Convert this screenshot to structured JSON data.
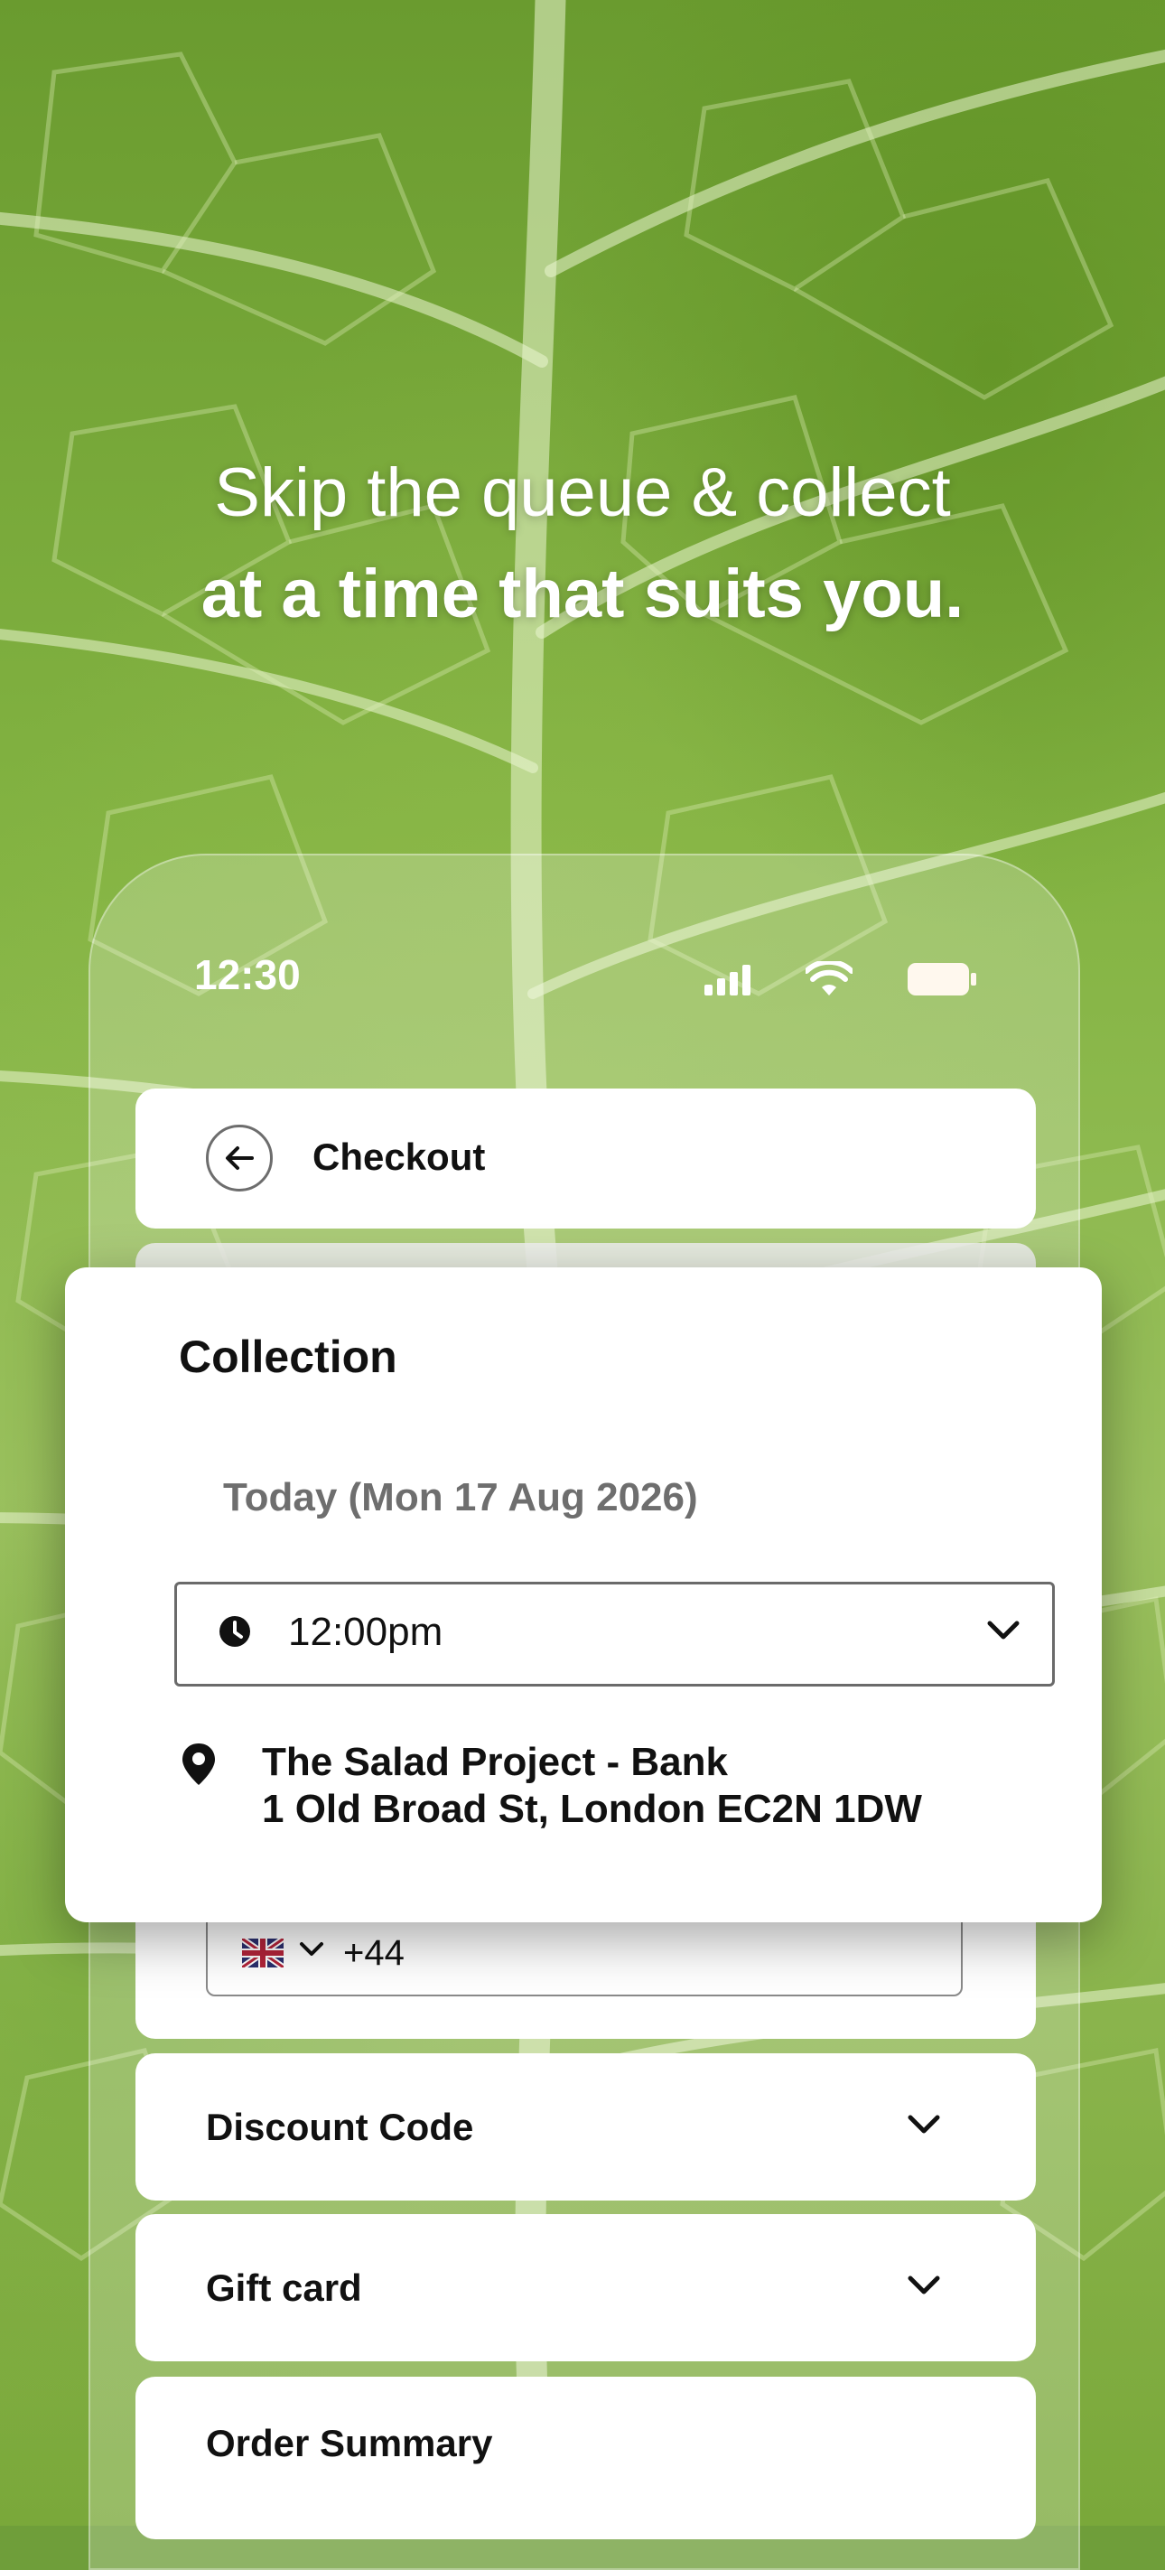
{
  "headline": {
    "line1": "Skip the queue & collect",
    "line2": "at a time that suits you."
  },
  "status_bar": {
    "time": "12:30",
    "icons": [
      "cellular-signal-icon",
      "wifi-icon",
      "battery-icon"
    ]
  },
  "checkout": {
    "title": "Checkout",
    "back_icon": "arrow-left-icon"
  },
  "collection": {
    "title": "Collection",
    "date": "Today (Mon 17 Aug 2026)",
    "time_value": "12:00pm",
    "store_name": "The Salad Project - Bank",
    "store_address": "1 Old Broad St, London EC2N 1DW"
  },
  "phone_field": {
    "country_flag": "uk-flag-icon",
    "dial_code": "+44"
  },
  "sections": {
    "discount_label": "Discount Code",
    "gift_label": "Gift card",
    "summary_label": "Order Summary"
  },
  "colors": {
    "leaf_green": "#7aa83a",
    "card_white": "#ffffff",
    "text_dark": "#111111",
    "muted_text": "#6e6e6e"
  }
}
